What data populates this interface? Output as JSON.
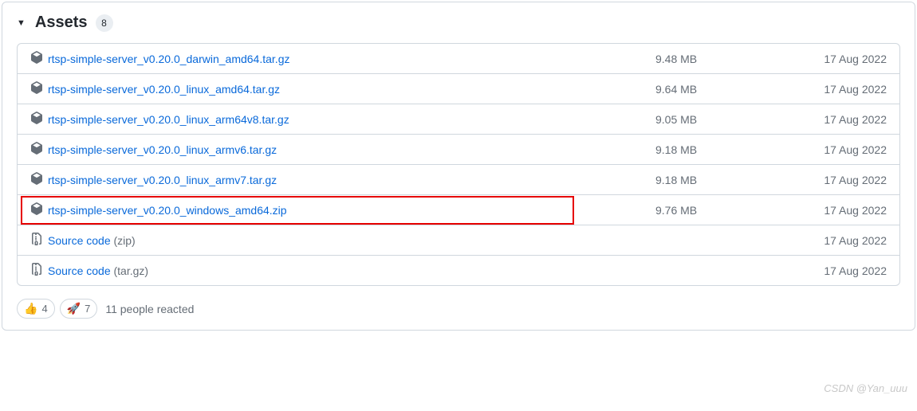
{
  "section": {
    "title": "Assets",
    "count": "8"
  },
  "assets": [
    {
      "icon": "package",
      "name": "rtsp-simple-server_v0.20.0_darwin_amd64.tar.gz",
      "size": "9.48 MB",
      "date": "17 Aug 2022",
      "highlight": false
    },
    {
      "icon": "package",
      "name": "rtsp-simple-server_v0.20.0_linux_amd64.tar.gz",
      "size": "9.64 MB",
      "date": "17 Aug 2022",
      "highlight": false
    },
    {
      "icon": "package",
      "name": "rtsp-simple-server_v0.20.0_linux_arm64v8.tar.gz",
      "size": "9.05 MB",
      "date": "17 Aug 2022",
      "highlight": false
    },
    {
      "icon": "package",
      "name": "rtsp-simple-server_v0.20.0_linux_armv6.tar.gz",
      "size": "9.18 MB",
      "date": "17 Aug 2022",
      "highlight": false
    },
    {
      "icon": "package",
      "name": "rtsp-simple-server_v0.20.0_linux_armv7.tar.gz",
      "size": "9.18 MB",
      "date": "17 Aug 2022",
      "highlight": false
    },
    {
      "icon": "package",
      "name": "rtsp-simple-server_v0.20.0_windows_amd64.zip",
      "size": "9.76 MB",
      "date": "17 Aug 2022",
      "highlight": true
    },
    {
      "icon": "file-zip",
      "name": "Source code ",
      "name_suffix": "(zip)",
      "size": "",
      "date": "17 Aug 2022",
      "highlight": false
    },
    {
      "icon": "file-zip",
      "name": "Source code ",
      "name_suffix": "(tar.gz)",
      "size": "",
      "date": "17 Aug 2022",
      "highlight": false
    }
  ],
  "reactions": {
    "items": [
      {
        "emoji": "👍",
        "count": "4"
      },
      {
        "emoji": "🚀",
        "count": "7"
      }
    ],
    "summary": "11 people reacted"
  },
  "watermark": "CSDN @Yan_uuu"
}
